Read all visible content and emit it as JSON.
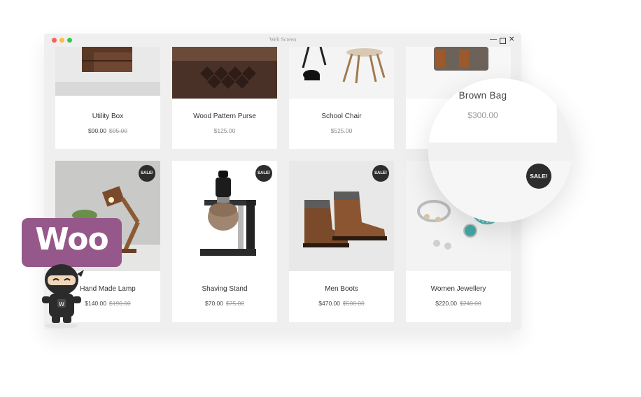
{
  "window": {
    "title": "Web Screen"
  },
  "products_row1": [
    {
      "name": "Utility Box",
      "price": "$90.00",
      "old_price": "$95.00"
    },
    {
      "name": "Wood Pattern Purse",
      "price": "$125.00"
    },
    {
      "name": "School Chair",
      "price": "$525.00"
    }
  ],
  "products_row2": [
    {
      "name": "Hand Made Lamp",
      "price": "$140.00",
      "old_price": "$190.00",
      "badge": "SALE!"
    },
    {
      "name": "Shaving Stand",
      "price": "$70.00",
      "old_price": "$75.00",
      "badge": "SALE!"
    },
    {
      "name": "Men Boots",
      "price": "$470.00",
      "old_price": "$500.00",
      "badge": "SALE!"
    },
    {
      "name": "Women Jewellery",
      "price": "$220.00",
      "old_price": "$240.00",
      "badge": "SALE!"
    }
  ],
  "zoom": {
    "name": "Brown Bag",
    "price": "$300.00",
    "badge": "SALE!"
  },
  "brand": {
    "logo_text": "Woo",
    "color": "#96588a"
  }
}
